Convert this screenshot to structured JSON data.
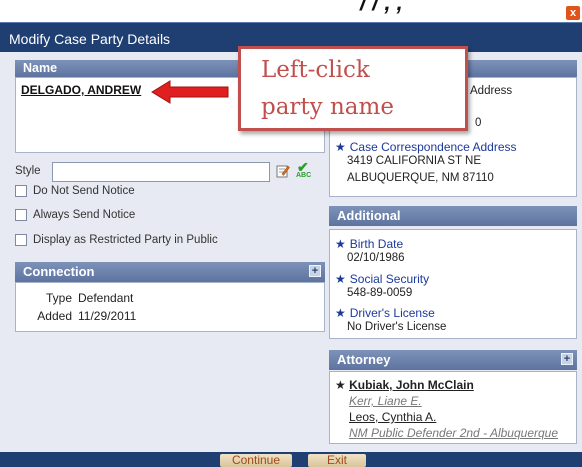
{
  "overlay_text": "/ / , ,",
  "window": {
    "title": "Modify Case Party Details",
    "close_glyph": "x"
  },
  "name_section": {
    "header": "Name",
    "party_name": "DELGADO, ANDREW"
  },
  "style": {
    "label": "Style",
    "value": "",
    "spell_label": "ABC"
  },
  "checkboxes": [
    {
      "label": "Do Not Send Notice",
      "checked": false
    },
    {
      "label": "Always Send Notice",
      "checked": false
    },
    {
      "label": "Display as Restricted Party in Public",
      "checked": false
    }
  ],
  "connection": {
    "header": "Connection",
    "plus": "+",
    "type_key": "Type",
    "type_value": "Defendant",
    "added_key": "Added",
    "added_value": "11/29/2011"
  },
  "address": {
    "address_label_partial": "Address",
    "address_partial_line": "0",
    "correspondence_label": "Case Correspondence Address",
    "line1": "3419 CALIFORNIA ST NE",
    "line2": "ALBUQUERQUE, NM 87110"
  },
  "additional": {
    "header": "Additional",
    "birth_label": "Birth Date",
    "birth_value": "02/10/1986",
    "ssn_label": "Social Security",
    "ssn_value": "548-89-0059",
    "dl_label": "Driver's License",
    "dl_value": "No Driver's License"
  },
  "attorney": {
    "header": "Attorney",
    "plus": "+",
    "star": "★",
    "primary": "Kubiak, John McClain",
    "secondary1": "Kerr, Liane E.",
    "secondary2": "Leos, Cynthia A.",
    "office": "NM Public Defender 2nd - Albuquerque"
  },
  "footer": {
    "continue_label": "Continue",
    "exit_label": "Exit"
  },
  "annotation": {
    "line1": "Left-click",
    "line2": "party name",
    "color": "#c0504d"
  },
  "colors": {
    "titlebar": "#1f3f72",
    "section_header": "#6e84ae",
    "link_blue": "#1d3a9b",
    "button_text": "#a04a1a"
  }
}
